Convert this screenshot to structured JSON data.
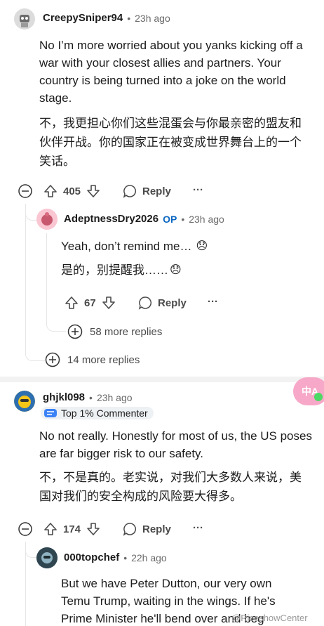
{
  "comments": [
    {
      "username": "CreepySniper94",
      "time": "23h ago",
      "text_en": "No I’m more worried about you yanks kicking off a war with your closest allies and partners. Your country is being turned into a joke on the world stage.",
      "text_zh": "不，我更担心你们这些混蛋会与你最亲密的盟友和伙伴开战。你的国家正在被变成世界舞台上的一个笑话。",
      "votes": "405",
      "reply_label": "Reply",
      "more_label": "···",
      "more_replies": "14 more replies"
    },
    {
      "username": "AdeptnessDry2026",
      "op_label": "OP",
      "time": "23h ago",
      "text_en": "Yeah, don’t remind me…",
      "text_zh": "是的，别提醒我……",
      "emoji": "😞",
      "votes": "67",
      "reply_label": "Reply",
      "more_label": "···",
      "more_replies": "58 more replies"
    },
    {
      "username": "ghjkl098",
      "time": "23h ago",
      "badge": "Top 1% Commenter",
      "text_en": "No not really. Honestly for most of us, the US poses are far bigger risk to our safety.",
      "text_zh": "不，不是真的。老实说，对我们大多数人来说，美国对我们的安全构成的风险要大得多。",
      "votes": "174",
      "reply_label": "Reply",
      "more_label": "···"
    },
    {
      "username": "000topchef",
      "time": "22h ago",
      "text_en": "But we have Peter Dutton, our very own Temu Trump, waiting in the wings. If he's Prime Minister he'll bend over and beg"
    }
  ],
  "separator": "•",
  "translate_button": "中A",
  "watermark": "@RiceshowCenter",
  "colors": {
    "accent": "#0a66c2",
    "translate_bg": "#f7a8c8"
  }
}
